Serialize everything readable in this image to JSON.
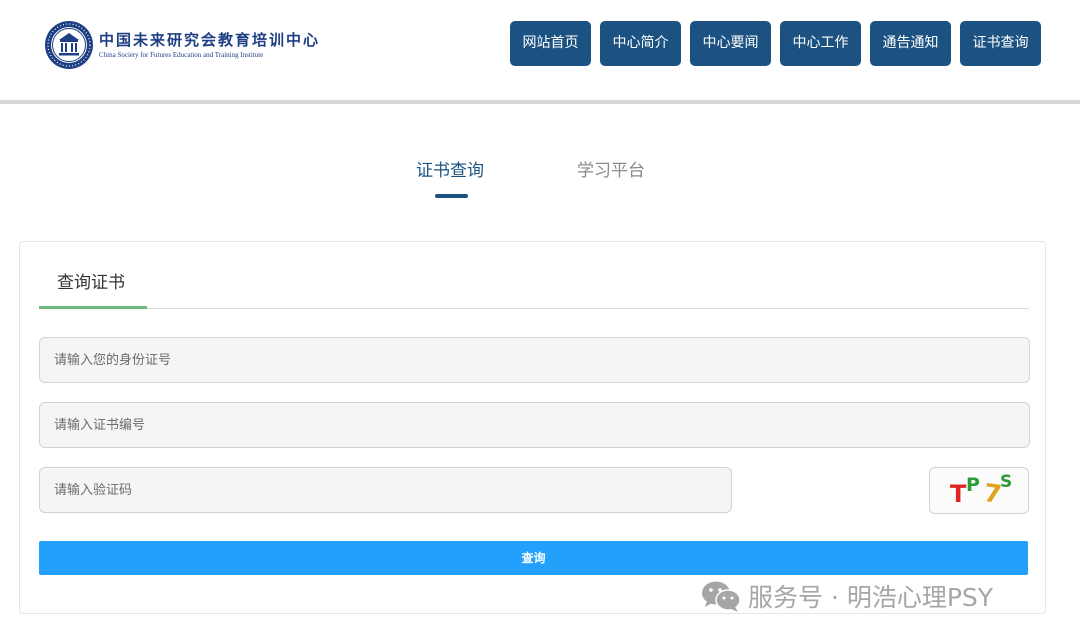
{
  "header": {
    "logo_cn": "中国未来研究会教育培训中心",
    "logo_en": "China Society for Futures Education and Training Institute",
    "logo_icon": "institution-emblem-icon",
    "nav": [
      {
        "label": "网站首页"
      },
      {
        "label": "中心简介"
      },
      {
        "label": "中心要闻"
      },
      {
        "label": "中心工作"
      },
      {
        "label": "通告通知"
      },
      {
        "label": "证书查询"
      }
    ]
  },
  "tabs": {
    "active": "证书查询",
    "inactive": "学习平台"
  },
  "form": {
    "title": "查询证书",
    "id_placeholder": "请输入您的身份证号",
    "cert_placeholder": "请输入证书编号",
    "captcha_placeholder": "请输入验证码",
    "captcha_chars": [
      "T",
      "P",
      "7",
      "S"
    ],
    "submit_label": "查询"
  },
  "watermark": {
    "text": "服务号 · 明浩心理PSY",
    "icon": "wechat-icon"
  },
  "colors": {
    "brand_blue": "#1b5282",
    "submit_blue": "#22a0fb",
    "tab_underline_green": "#6fba80"
  }
}
